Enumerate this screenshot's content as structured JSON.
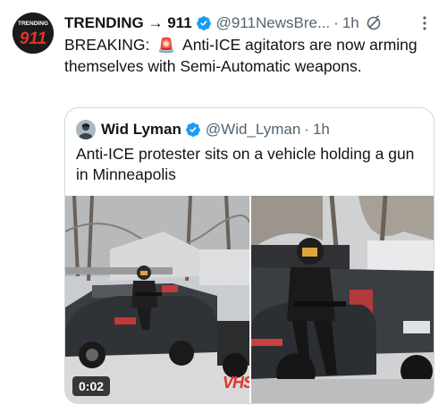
{
  "tweet": {
    "avatar": {
      "label_top": "TRENDING",
      "label_number": "911",
      "icon": "news-brand-avatar"
    },
    "display_name": "TRENDING → 911",
    "handle": "@911NewsBre...",
    "separator": "·",
    "time": "1h",
    "verified_icon": "verified-badge-icon",
    "restricted_icon": "no-reply-icon",
    "more_icon": "more-vertical-icon",
    "text_prefix": "BREAKING:",
    "siren_emoji": "🚨",
    "text_body": "Anti-ICE agitators are now arming themselves with Semi-Automatic weapons."
  },
  "quote": {
    "display_name": "Wid Lyman",
    "handle": "@Wid_Lyman",
    "separator": "·",
    "time": "1h",
    "text": "Anti-ICE protester sits on a vehicle holding a gun in Minneapolis",
    "media": {
      "duration": "0:02",
      "watermark": "VHS"
    }
  },
  "colors": {
    "text": "#0f1419",
    "secondary": "#536471",
    "verified": "#1d9bf0",
    "border": "#cfd9de"
  }
}
